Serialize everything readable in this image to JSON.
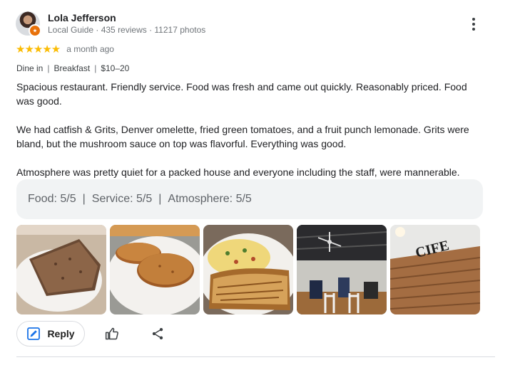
{
  "review": {
    "author": {
      "name": "Lola Jefferson",
      "meta": "Local Guide · 435 reviews · 11217 photos"
    },
    "rating": 5,
    "stars_text": "★★★★★",
    "time": "a month ago",
    "tags": [
      "Dine in",
      "Breakfast",
      "$10–20"
    ],
    "tag_separator": "|",
    "paragraphs": [
      "Spacious restaurant. Friendly service. Food was fresh and came out quickly. Reasonably priced. Food was good.",
      "We had catfish & Grits, Denver omelette, fried green tomatoes, and a fruit punch lemonade. Grits were bland, but the mushroom sauce on top was flavorful. Everything was good.",
      "Atmosphere was pretty quiet for a packed house and everyone including the staff, were mannerable."
    ],
    "scores": [
      {
        "text": "Food: 5/5"
      },
      {
        "text": "Service: 5/5"
      },
      {
        "text": "Atmosphere: 5/5"
      }
    ],
    "score_separator": "|",
    "photo_signage": "CIFE"
  },
  "actions": {
    "reply_label": "Reply"
  },
  "colors": {
    "star": "#fbbc04",
    "accent_blue": "#1a73e8",
    "secondary_text": "#70757a",
    "score_bg": "#f1f3f4"
  },
  "icons": [
    "more-vert-icon",
    "reply-edit-icon",
    "thumb-up-icon",
    "share-icon",
    "local-guide-badge-icon"
  ]
}
